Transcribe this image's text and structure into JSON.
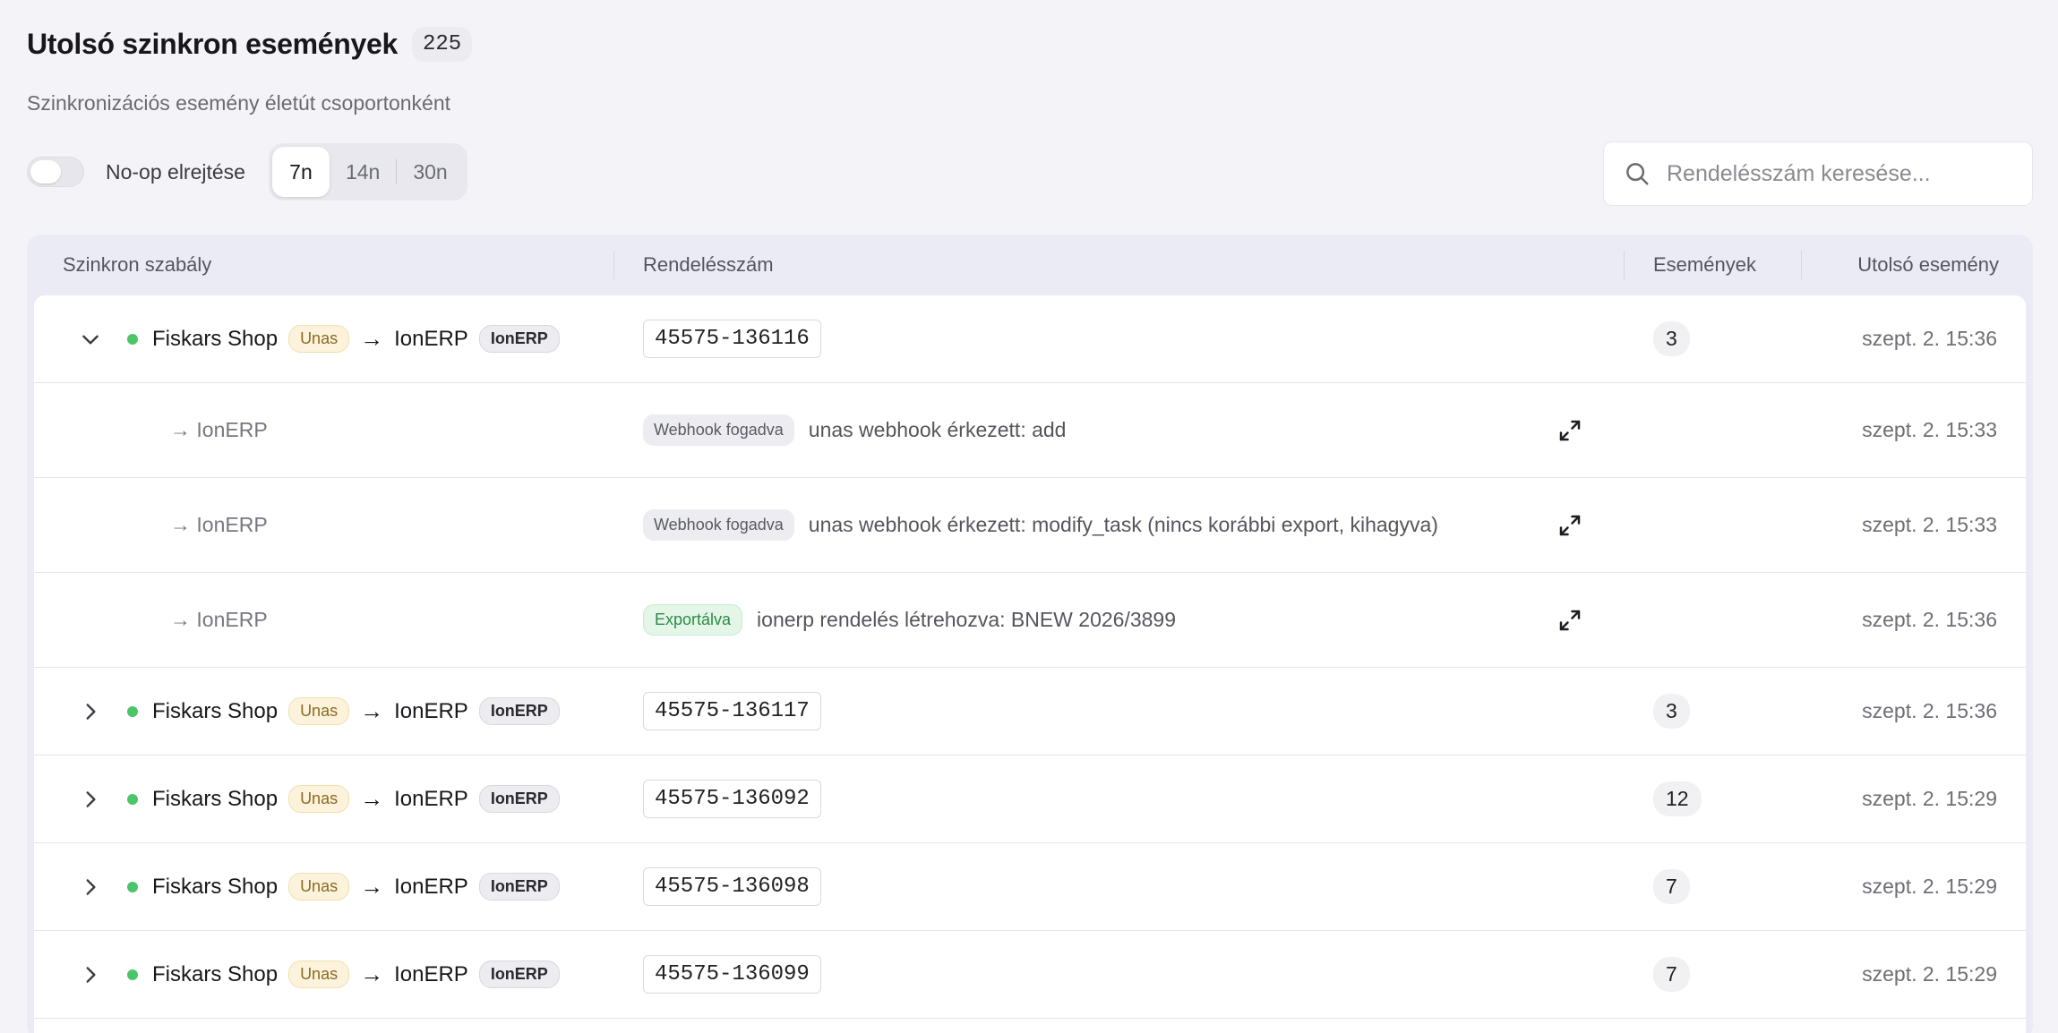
{
  "header": {
    "title": "Utolsó szinkron események",
    "count": "225",
    "subtitle": "Szinkronizációs esemény életút csoportonként"
  },
  "controls": {
    "toggle_label": "No-op elrejtése",
    "toggle_on": false,
    "ranges": [
      {
        "label": "7n",
        "active": true
      },
      {
        "label": "14n",
        "active": false
      },
      {
        "label": "30n",
        "active": false
      }
    ]
  },
  "search": {
    "placeholder": "Rendelésszám keresése..."
  },
  "table": {
    "columns": {
      "rule": "Szinkron szabály",
      "order": "Rendelésszám",
      "events": "Események",
      "last": "Utolsó esemény"
    },
    "groups": [
      {
        "expanded": true,
        "shop": "Fiskars Shop",
        "source": "Unas",
        "arrow": "→",
        "target_name": "IonERP",
        "target_badge": "IonERP",
        "order": "45575-136116",
        "events": "3",
        "last": "szept. 2. 15:36",
        "children": [
          {
            "target": "→ IonERP",
            "status": "Webhook fogadva",
            "status_type": "webhook",
            "message": "unas webhook érkezett: add",
            "time": "szept. 2. 15:33"
          },
          {
            "target": "→ IonERP",
            "status": "Webhook fogadva",
            "status_type": "webhook",
            "message": "unas webhook érkezett: modify_task (nincs korábbi export, kihagyva)",
            "time": "szept. 2. 15:33"
          },
          {
            "target": "→ IonERP",
            "status": "Exportálva",
            "status_type": "export",
            "message": "ionerp rendelés létrehozva: BNEW 2026/3899",
            "time": "szept. 2. 15:36"
          }
        ]
      },
      {
        "expanded": false,
        "shop": "Fiskars Shop",
        "source": "Unas",
        "arrow": "→",
        "target_name": "IonERP",
        "target_badge": "IonERP",
        "order": "45575-136117",
        "events": "3",
        "last": "szept. 2. 15:36"
      },
      {
        "expanded": false,
        "shop": "Fiskars Shop",
        "source": "Unas",
        "arrow": "→",
        "target_name": "IonERP",
        "target_badge": "IonERP",
        "order": "45575-136092",
        "events": "12",
        "last": "szept. 2. 15:29"
      },
      {
        "expanded": false,
        "shop": "Fiskars Shop",
        "source": "Unas",
        "arrow": "→",
        "target_name": "IonERP",
        "target_badge": "IonERP",
        "order": "45575-136098",
        "events": "7",
        "last": "szept. 2. 15:29"
      },
      {
        "expanded": false,
        "shop": "Fiskars Shop",
        "source": "Unas",
        "arrow": "→",
        "target_name": "IonERP",
        "target_badge": "IonERP",
        "order": "45575-136099",
        "events": "7",
        "last": "szept. 2. 15:29"
      }
    ]
  },
  "colors": {
    "status_dot": "#4cc46a",
    "unas_bg": "#fdf3dc",
    "export_bg": "#e3f6e7",
    "page_bg": "#f4f4f8"
  },
  "icons": {
    "search": "search-icon",
    "expand": "expand-icon",
    "chevron_down": "chevron-down-icon",
    "chevron_right": "chevron-right-icon"
  }
}
